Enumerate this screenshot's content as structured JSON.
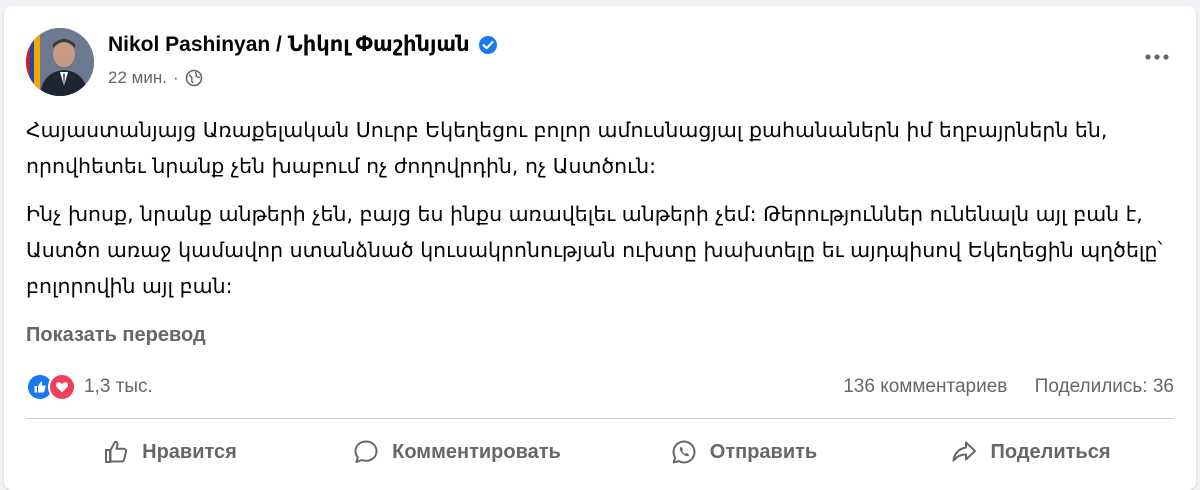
{
  "post": {
    "author": "Nikol Pashinyan / Նիկոլ Փաշինյան",
    "time": "22 мин.",
    "separator": "·",
    "paragraphs": [
      "Հայաստանյայց Առաքելական Սուրբ Եկեղեցու բոլոր ամուսնացյալ քահանաներն իմ եղբայրներն են, որովհետեւ նրանք չեն խաբում ոչ ժողովրդին, ոչ Աստծուն:",
      "Ինչ խոսք, նրանք անթերի չեն, բայց ես ինքս առավելեւ անթերի չեմ: Թերություններ ունենալն այլ բան է, Աստծո առաջ կամավոր ստանձնած կուսակրոնության ուխտը խախտելը եւ այդպիսով Եկեղեցին պղծելը՝ բոլորովին այլ բան:"
    ],
    "translate_label": "Показать перевод"
  },
  "stats": {
    "reactions_count": "1,3 тыс.",
    "comments": "136 комментариев",
    "shares": "Поделились: 36"
  },
  "actions": {
    "like": "Нравится",
    "comment": "Комментировать",
    "send": "Отправить",
    "share": "Поделиться"
  },
  "icons": {
    "verified": "verified-badge-icon",
    "globe": "globe-icon",
    "more": "more-dots-icon",
    "like_reaction": "like-reaction-icon",
    "love_reaction": "love-reaction-icon"
  },
  "colors": {
    "brand_blue": "#1877f2",
    "love_red": "#f33e58",
    "secondary_text": "#65676b"
  }
}
